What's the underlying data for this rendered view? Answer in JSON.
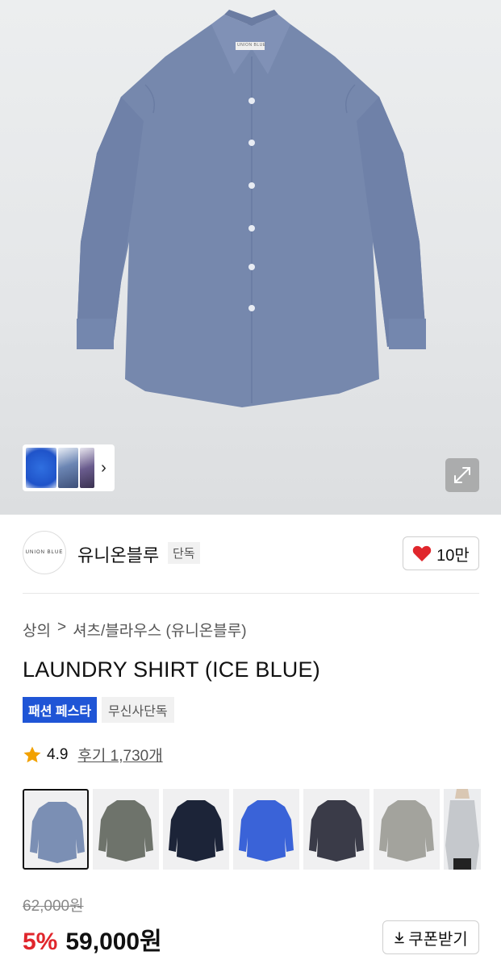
{
  "brand": {
    "logo_text": "UNION BLUE",
    "name": "유니온블루",
    "tag": "단독",
    "likes": "10만"
  },
  "breadcrumb": {
    "category": "상의",
    "separator": ">",
    "subcategory": "셔츠/블라우스 (유니온블루)"
  },
  "product": {
    "title": "LAUNDRY SHIRT (ICE BLUE)",
    "label_tag": "UNION BLUE",
    "badges": [
      "패션 페스타",
      "무신사단독"
    ],
    "rating": "4.9",
    "reviews": "후기 1,730개",
    "original_price": "62,000원",
    "discount": "5%",
    "price": "59,000원"
  },
  "image_viewer": {
    "thumbnail_nav_icon": "chevron-right-icon",
    "expand_icon": "expand-icon"
  },
  "coupon_button": {
    "label": "쿠폰받기",
    "icon": "download-icon"
  },
  "color_options": [
    {
      "name": "ice-blue",
      "color": "#7b8fb4",
      "selected": true
    },
    {
      "name": "khaki",
      "color": "#6e736b",
      "selected": false
    },
    {
      "name": "navy",
      "color": "#1c2438",
      "selected": false
    },
    {
      "name": "blue",
      "color": "#3a63d8",
      "selected": false
    },
    {
      "name": "charcoal",
      "color": "#3a3b48",
      "selected": false
    },
    {
      "name": "gray",
      "color": "#a3a39d",
      "selected": false
    },
    {
      "name": "light-gray-model",
      "color": "#c5c8cc",
      "selected": false
    }
  ],
  "colors": {
    "accent_red": "#e0262c",
    "badge_blue": "#1f55d6",
    "heart_red": "#e0262c",
    "star_yellow": "#f2a100"
  }
}
